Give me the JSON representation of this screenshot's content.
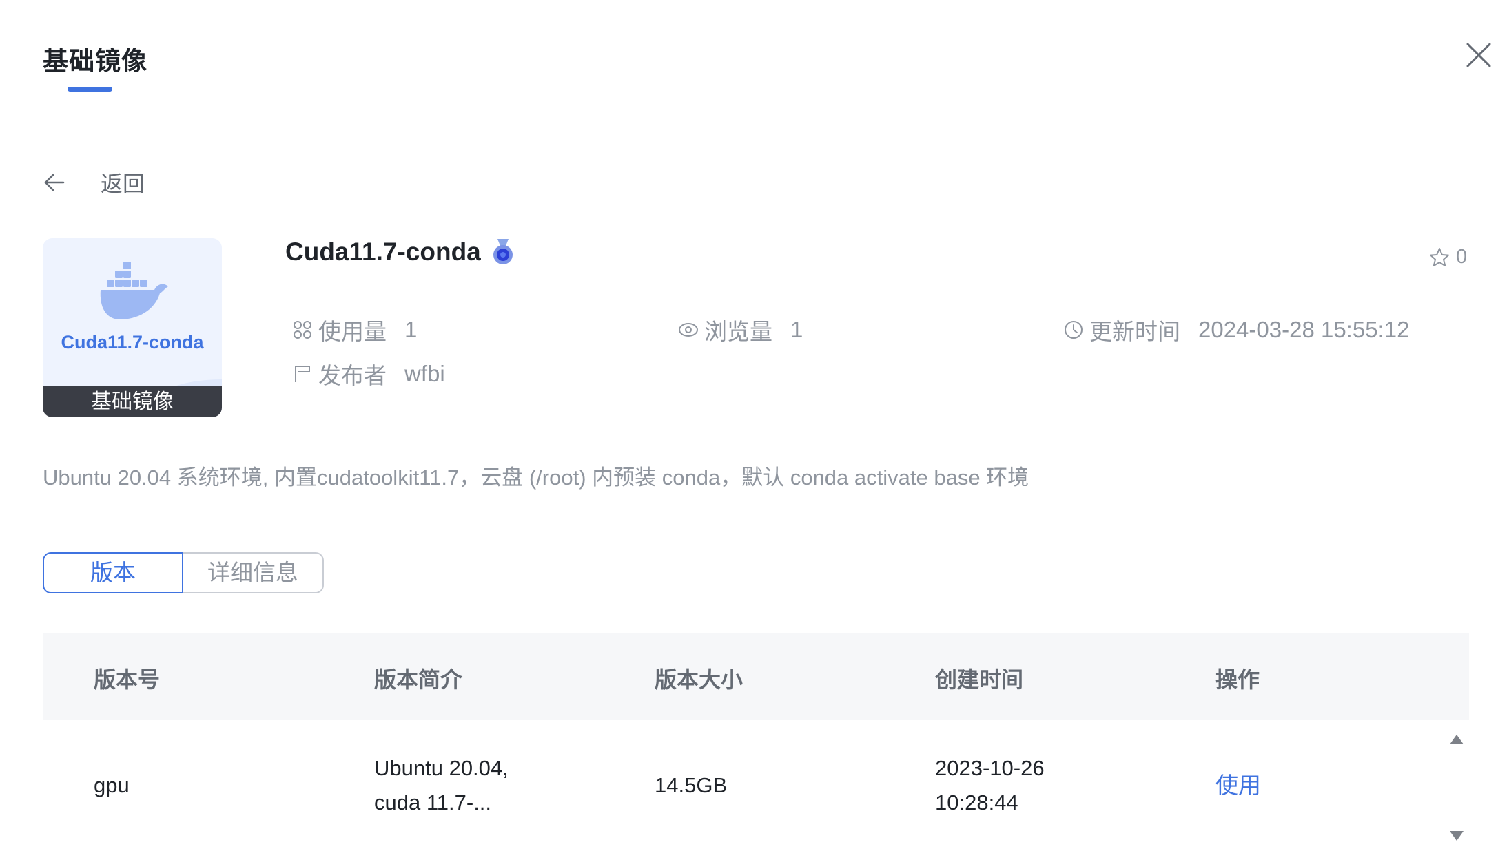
{
  "dialog": {
    "title": "基础镜像"
  },
  "back": {
    "label": "返回"
  },
  "card": {
    "name": "Cuda11.7-conda",
    "tag": "基础镜像"
  },
  "image": {
    "title": "Cuda11.7-conda",
    "favorites": "0",
    "usage_label": "使用量",
    "usage_value": "1",
    "views_label": "浏览量",
    "views_value": "1",
    "updated_label": "更新时间",
    "updated_value": "2024-03-28 15:55:12",
    "publisher_label": "发布者",
    "publisher_value": "wfbi",
    "description": "Ubuntu 20.04 系统环境, 内置cudatoolkit11.7，云盘 (/root) 内预装 conda，默认 conda activate base 环境"
  },
  "tabs": [
    {
      "label": "版本",
      "active": true
    },
    {
      "label": "详细信息",
      "active": false
    }
  ],
  "table": {
    "headers": [
      "版本号",
      "版本简介",
      "版本大小",
      "创建时间",
      "操作"
    ],
    "rows": [
      {
        "version": "gpu",
        "intro_line1": "Ubuntu 20.04,",
        "intro_line2": "cuda 11.7-...",
        "size": "14.5GB",
        "created_date": "2023-10-26",
        "created_time": "10:28:44",
        "action": "使用"
      }
    ]
  },
  "colors": {
    "accent": "#3f73e0",
    "text_muted": "#8f959e",
    "header_bg": "#f6f7f9",
    "tag_bg": "#3a3d45"
  },
  "icons": [
    "close-icon",
    "back-arrow-icon",
    "docker-whale-icon",
    "medal-badge-icon",
    "star-icon",
    "usage-icon",
    "eye-icon",
    "clock-icon",
    "publisher-icon",
    "scroll-up-icon",
    "scroll-down-icon"
  ]
}
